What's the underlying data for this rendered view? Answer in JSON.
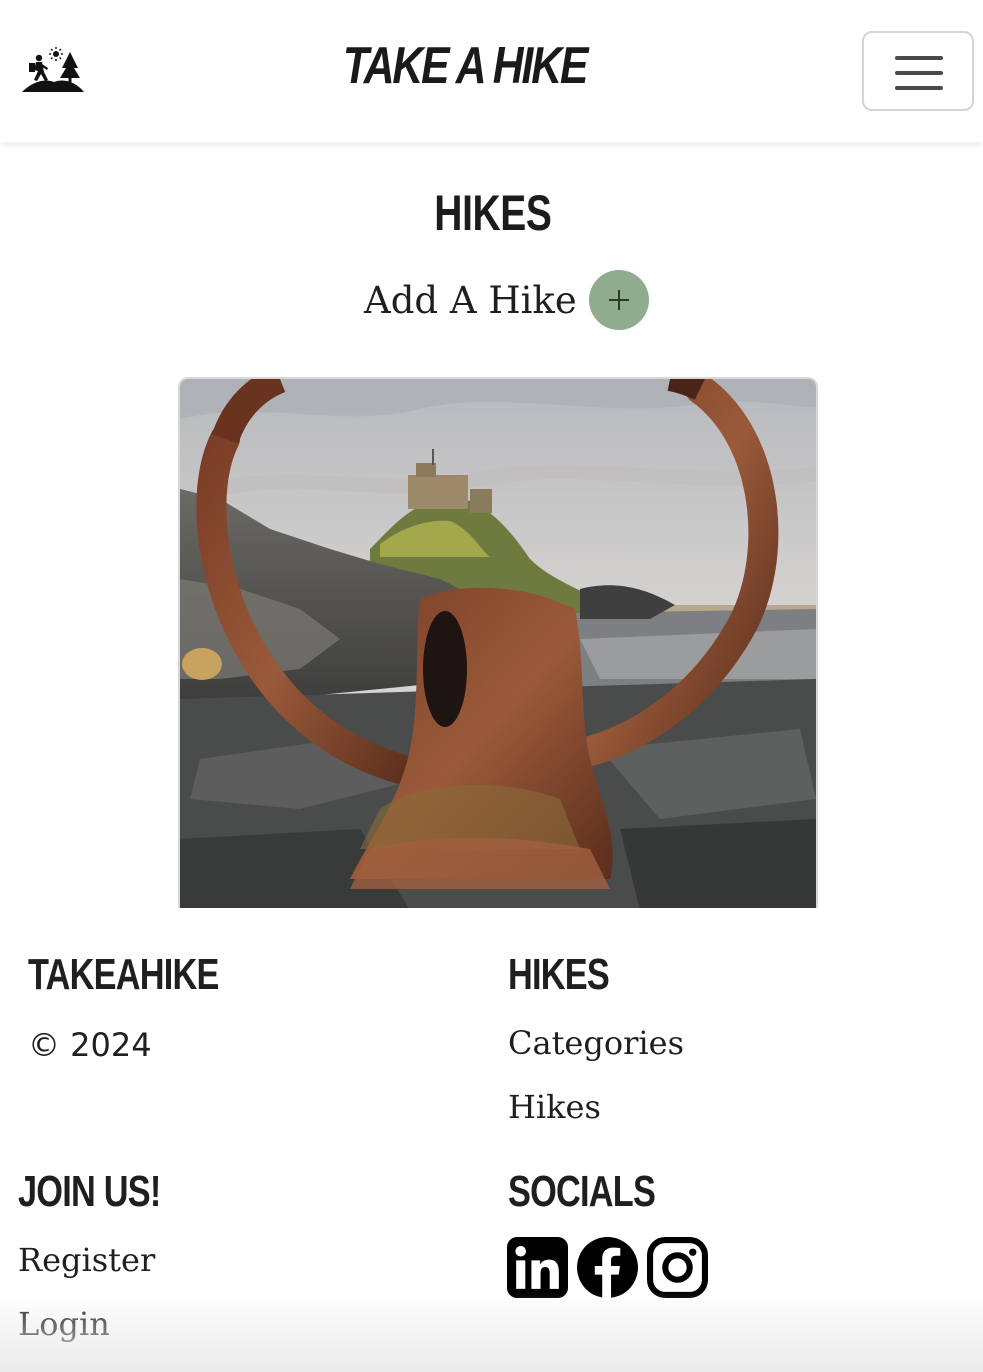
{
  "header": {
    "brand": "TAKE A HIKE",
    "logo_icon": "hiker-trees-logo-icon",
    "menu_icon": "hamburger-menu-icon"
  },
  "main": {
    "title": "HIKES",
    "add_hike_label": "Add A Hike",
    "add_hike_icon": "plus-icon",
    "accent_color": "#8fac8e",
    "cards": [
      {
        "image": "rusted-iron-ring-castle-photo"
      }
    ]
  },
  "footer": {
    "brand_heading": "TAKEAHIKE",
    "copyright": "© 2024",
    "hikes_heading": "HIKES",
    "hikes_links": [
      "Categories",
      "Hikes"
    ],
    "join_heading": "JOIN US!",
    "join_links": [
      "Register",
      "Login"
    ],
    "socials_heading": "SOCIALS",
    "socials": [
      "linkedin-icon",
      "facebook-icon",
      "instagram-icon"
    ]
  }
}
